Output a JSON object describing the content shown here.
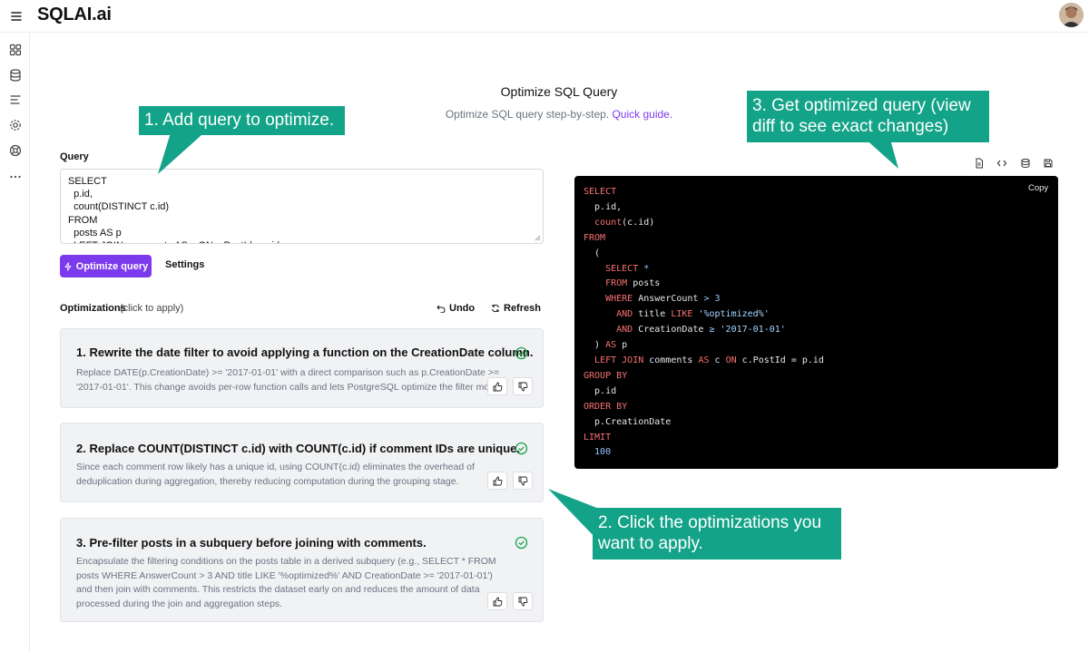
{
  "app": {
    "brand": "SQLAI.ai"
  },
  "header": {
    "title": "Optimize SQL Query",
    "subtitle_prefix": "Optimize SQL query step-by-step.",
    "guide_link": "Quick guide."
  },
  "query": {
    "label": "Query",
    "text": "SELECT\n  p.id,\n  count(DISTINCT c.id)\nFROM\n  posts AS p\n  LEFT JOIN comments AS c ON c.PostId = p.id",
    "optimize_label": "Optimize query",
    "settings_label": "Settings"
  },
  "optimizations": {
    "label": "Optimizations",
    "hint": "(click to apply)",
    "undo_label": "Undo",
    "refresh_label": "Refresh",
    "items": [
      {
        "title": "1. Rewrite the date filter to avoid applying a function on the CreationDate column.",
        "description": "Replace DATE(p.CreationDate) >= '2017-01-01' with a direct comparison such as p.CreationDate >= '2017-01-01'. This change avoids per-row function calls and lets PostgreSQL optimize the filter more efficiently."
      },
      {
        "title": "2. Replace COUNT(DISTINCT c.id) with COUNT(c.id) if comment IDs are unique.",
        "description": "Since each comment row likely has a unique id, using COUNT(c.id) eliminates the overhead of deduplication during aggregation, thereby reducing computation during the grouping stage."
      },
      {
        "title": "3. Pre-filter posts in a subquery before joining with comments.",
        "description": "Encapsulate the filtering conditions on the posts table in a derived subquery (e.g., SELECT * FROM posts WHERE AnswerCount > 3 AND title LIKE '%optimized%' AND CreationDate >= '2017-01-01') and then join with comments. This restricts the dataset early on and reduces the amount of data processed during the join and aggregation steps."
      }
    ]
  },
  "result": {
    "copy_label": "Copy",
    "toolbar_icons": [
      "document-icon",
      "code-icon",
      "database-icon",
      "save-icon"
    ],
    "code_lines": [
      [
        [
          "kw",
          "SELECT"
        ]
      ],
      [
        [
          "",
          "  p.id,"
        ]
      ],
      [
        [
          "",
          "  "
        ],
        [
          "kw",
          "count"
        ],
        [
          "",
          "(c.id)"
        ]
      ],
      [
        [
          "kw",
          "FROM"
        ]
      ],
      [
        [
          "",
          "  ("
        ]
      ],
      [
        [
          "",
          "    "
        ],
        [
          "kw",
          "SELECT"
        ],
        [
          "op",
          " *"
        ]
      ],
      [
        [
          "",
          "    "
        ],
        [
          "kw",
          "FROM"
        ],
        [
          "",
          " posts"
        ]
      ],
      [
        [
          "",
          "    "
        ],
        [
          "kw",
          "WHERE"
        ],
        [
          "",
          " AnswerCount "
        ],
        [
          "op",
          ">"
        ],
        [
          "num",
          " 3"
        ]
      ],
      [
        [
          "",
          "      "
        ],
        [
          "kw",
          "AND"
        ],
        [
          "",
          " title "
        ],
        [
          "kw",
          "LIKE"
        ],
        [
          "str",
          " '%optimized%'"
        ]
      ],
      [
        [
          "",
          "      "
        ],
        [
          "kw",
          "AND"
        ],
        [
          "",
          " CreationDate "
        ],
        [
          "op",
          "≥"
        ],
        [
          "str",
          " '2017-01-01'"
        ]
      ],
      [
        [
          "",
          "  ) "
        ],
        [
          "kw",
          "AS"
        ],
        [
          "",
          " p"
        ]
      ],
      [
        [
          "",
          "  "
        ],
        [
          "kw",
          "LEFT JOIN"
        ],
        [
          "",
          " comments "
        ],
        [
          "kw",
          "AS"
        ],
        [
          "",
          " c "
        ],
        [
          "kw",
          "ON"
        ],
        [
          "",
          " c.PostId = p.id"
        ]
      ],
      [
        [
          "kw",
          "GROUP BY"
        ]
      ],
      [
        [
          "",
          "  p.id"
        ]
      ],
      [
        [
          "kw",
          "ORDER BY"
        ]
      ],
      [
        [
          "",
          "  p.CreationDate"
        ]
      ],
      [
        [
          "kw",
          "LIMIT"
        ]
      ],
      [
        [
          "num",
          "  100"
        ]
      ]
    ]
  },
  "annotations": {
    "step1": "1. Add query to optimize.",
    "step2": "2. Click the optimizations you want to apply.",
    "step3": "3. Get optimized query (view diff to see exact changes)"
  },
  "colors": {
    "accent": "#7c3aed",
    "callout": "#13a388",
    "check": "#16a34a"
  }
}
